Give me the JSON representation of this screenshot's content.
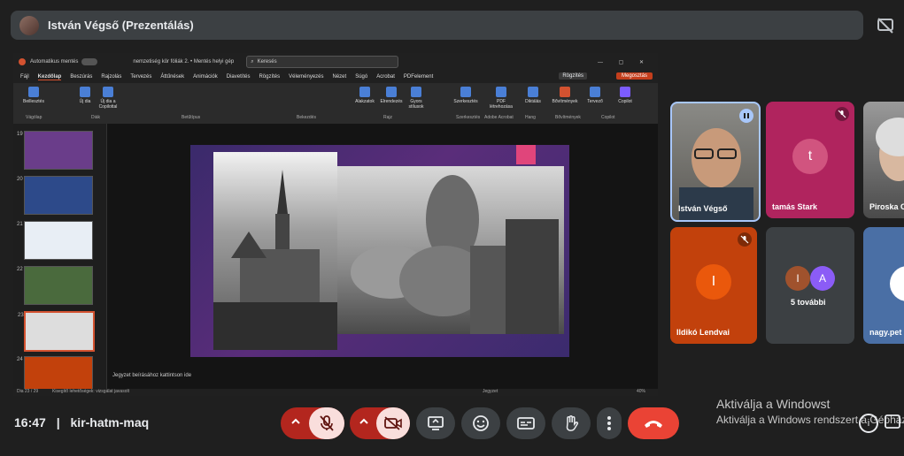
{
  "header": {
    "presenter_title": "István Végső (Prezentálás)"
  },
  "ppt": {
    "autosave_label": "Automatikus mentés",
    "file_name": "nemzetiség kör fóliák 2. • Mentés helyi gép",
    "search_placeholder": "Keresés",
    "menu": [
      "Fájl",
      "Kezdőlap",
      "Beszúrás",
      "Rajzolás",
      "Tervezés",
      "Áttűnések",
      "Animációk",
      "Diavetítés",
      "Rögzítés",
      "Véleményezés",
      "Nézet",
      "Súgó",
      "Acrobat",
      "PDFelement"
    ],
    "record_button": "Rögzítés",
    "share_button": "Megosztás",
    "ribbon_groups": [
      "Vágólap",
      "Diák",
      "Betűtípus",
      "Bekezdés",
      "Rajz",
      "Szerkesztés",
      "Adobe Acrobat",
      "Hang",
      "Bővítmények",
      "Copilot"
    ],
    "ribbon_buttons": [
      "Beillesztés",
      "Új dia",
      "Új dia a Copilottal",
      "Alakzatok",
      "Elrendezés",
      "Gyors stílusok",
      "Szerkesztés",
      "PDF létrehozása",
      "Diktálás",
      "Bővítmények",
      "Tervező",
      "Copilot"
    ],
    "slide_numbers": [
      "19",
      "20",
      "21",
      "22",
      "23",
      "24"
    ],
    "notes_placeholder": "Jegyzet beírásához kattintson ide",
    "status_left": "Dia 23 / 29",
    "status_accessibility": "Kisegítő lehetőségek: vizsgálat javasolt",
    "status_notes": "Jegyzet",
    "zoom": "40%"
  },
  "participants": [
    {
      "name": "István Végső",
      "initial": "",
      "color": "#2a2a2a"
    },
    {
      "name": "tamás Stark",
      "initial": "t",
      "color": "#b0245e"
    },
    {
      "name": "Piroska C",
      "initial": "",
      "color": "#5a5a5a"
    },
    {
      "name": "Ildikó Lendvai",
      "initial": "I",
      "color": "#c2410c"
    },
    {
      "name": "5 további",
      "initial": "",
      "color": "#3c4043"
    },
    {
      "name": "nagy.pet",
      "initial": "",
      "color": "#4a6fa5"
    }
  ],
  "more_avatars": [
    "I",
    "A"
  ],
  "footer": {
    "time": "16:47",
    "separator": "|",
    "meeting_code": "kir-hatm-maq"
  },
  "watermark": {
    "line1": "Aktiválja a Windowst",
    "line2": "Aktiválja a Windows rendszert a Gépházban."
  },
  "colors": {
    "accent_red": "#f28b82",
    "danger_red": "#b3261e",
    "end_call": "#ea4335",
    "panel": "#3c4043"
  }
}
